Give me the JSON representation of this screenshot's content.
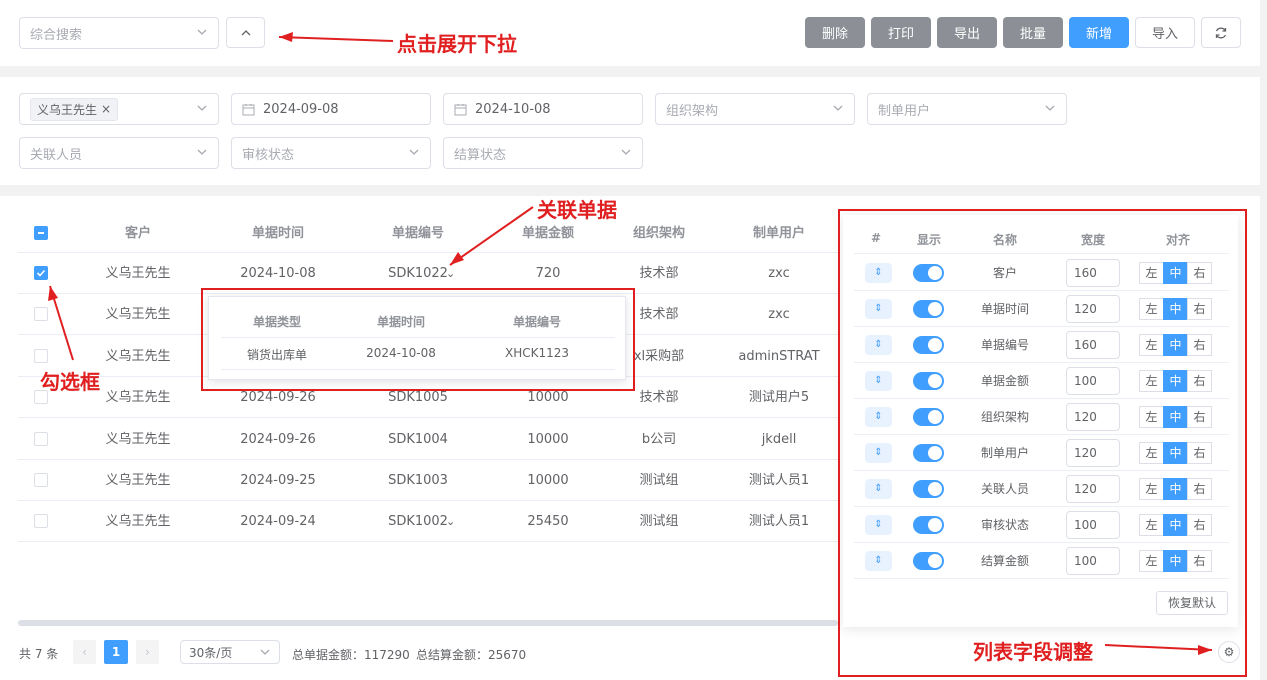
{
  "toolbar": {
    "search_placeholder": "综合搜索",
    "buttons": {
      "delete": "删除",
      "print": "打印",
      "export": "导出",
      "batch": "批量",
      "add": "新增",
      "import": "导入"
    }
  },
  "filters": {
    "customer_tag": "义乌王先生",
    "date_start": "2024-09-08",
    "date_end": "2024-10-08",
    "org_placeholder": "组织架构",
    "creator_placeholder": "制单用户",
    "related_placeholder": "关联人员",
    "audit_placeholder": "审核状态",
    "settle_placeholder": "结算状态"
  },
  "table": {
    "headers": [
      "客户",
      "单据时间",
      "单据编号",
      "单据金额",
      "组织架构",
      "制单用户"
    ],
    "rows": [
      [
        "义乌王先生",
        "2024-10-08",
        "SDK1022",
        "720",
        "技术部",
        "zxc"
      ],
      [
        "义乌王先生",
        "",
        "",
        "",
        "技术部",
        "zxc"
      ],
      [
        "义乌王先生",
        "",
        "",
        "",
        "xl采购部",
        "adminSTRAT"
      ],
      [
        "义乌王先生",
        "2024-09-26",
        "SDK1005",
        "10000",
        "技术部",
        "测试用户5"
      ],
      [
        "义乌王先生",
        "2024-09-26",
        "SDK1004",
        "10000",
        "b公司",
        "jkdell"
      ],
      [
        "义乌王先生",
        "2024-09-25",
        "SDK1003",
        "10000",
        "测试组",
        "测试人员1"
      ],
      [
        "义乌王先生",
        "2024-09-24",
        "SDK1002",
        "25450",
        "测试组",
        "测试人员1"
      ]
    ]
  },
  "popup": {
    "headers": [
      "单据类型",
      "单据时间",
      "单据编号"
    ],
    "row": [
      "销货出库单",
      "2024-10-08",
      "XHCK1123"
    ]
  },
  "config": {
    "headers": [
      "#",
      "显示",
      "名称",
      "宽度",
      "对齐"
    ],
    "align_labels": [
      "左",
      "中",
      "右"
    ],
    "rows": [
      {
        "name": "客户",
        "width": "160"
      },
      {
        "name": "单据时间",
        "width": "120"
      },
      {
        "name": "单据编号",
        "width": "160"
      },
      {
        "name": "单据金额",
        "width": "100"
      },
      {
        "name": "组织架构",
        "width": "120"
      },
      {
        "name": "制单用户",
        "width": "120"
      },
      {
        "name": "关联人员",
        "width": "120"
      },
      {
        "name": "审核状态",
        "width": "100"
      },
      {
        "name": "结算金额",
        "width": "100"
      }
    ],
    "reset": "恢复默认"
  },
  "footer": {
    "total": "共 7 条",
    "page": "1",
    "page_size": "30条/页",
    "sum_amount": "总单据金额：117290",
    "sum_settle": "总结算金额：25670"
  },
  "annotations": {
    "dropdown": "点击展开下拉",
    "related": "关联单据",
    "checkbox": "勾选框",
    "fields": "列表字段调整"
  },
  "colors": {
    "primary": "#409eff",
    "annotation": "#e02020",
    "gray_button": "#8c9096"
  }
}
